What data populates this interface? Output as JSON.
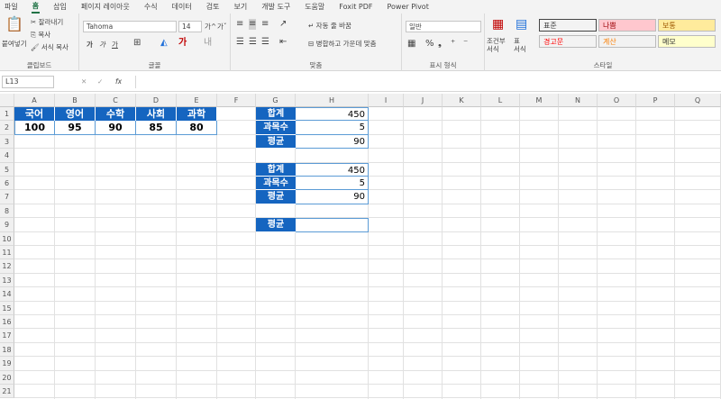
{
  "ribbon": {
    "tabs": [
      "파일",
      "홈",
      "삽입",
      "페이지 레이아웃",
      "수식",
      "데이터",
      "검토",
      "보기",
      "개발 도구",
      "도움말",
      "Foxit PDF",
      "Power Pivot"
    ],
    "active_tab": "홈",
    "clipboard": {
      "paste": "붙여넣기",
      "cut": "잘라내기",
      "copy": "복사",
      "format_painter": "서식 복사",
      "label": "클립보드"
    },
    "font": {
      "name": "Tahoma",
      "size": "14",
      "grow": "가^",
      "shrink": "가ˇ",
      "bold": "가",
      "italic": "가",
      "underline": "가",
      "label": "글꼴"
    },
    "alignment": {
      "wrap": "자동 줄 바꿈",
      "merge": "병합하고 가운데 맞춤",
      "label": "맞춤"
    },
    "number": {
      "format": "일반",
      "label": "표시 형식"
    },
    "styles": {
      "conditional": "조건부\n서식",
      "table": "표\n서식",
      "label": "스타일",
      "cells": [
        {
          "text": "표준",
          "bg": "#ffffff",
          "fg": "#000000"
        },
        {
          "text": "나쁨",
          "bg": "#ffc7ce",
          "fg": "#9c0006"
        },
        {
          "text": "보통",
          "bg": "#ffeb9c",
          "fg": "#9c5700"
        },
        {
          "text": "경고문",
          "bg": "#ffffff",
          "fg": "#ff0000"
        },
        {
          "text": "계산",
          "bg": "#f2f2f2",
          "fg": "#fa7d00"
        },
        {
          "text": "메모",
          "bg": "#ffffcc",
          "fg": "#000000"
        }
      ]
    }
  },
  "formula_bar": {
    "name_box": "L13",
    "cancel": "✕",
    "enter": "✓",
    "fx": "fx",
    "content": ""
  },
  "columns": [
    "A",
    "B",
    "C",
    "D",
    "E",
    "F",
    "G",
    "H",
    "I",
    "J",
    "K",
    "L",
    "M",
    "N",
    "O",
    "P",
    "Q"
  ],
  "rows": [
    "1",
    "2",
    "3",
    "4",
    "5",
    "6",
    "7",
    "8",
    "9",
    "10",
    "11",
    "12",
    "13",
    "14",
    "15",
    "16",
    "17",
    "18",
    "19",
    "20",
    "21"
  ],
  "table1": {
    "headers": [
      "국어",
      "영어",
      "수학",
      "사회",
      "과학"
    ],
    "values": [
      "100",
      "95",
      "90",
      "85",
      "80"
    ]
  },
  "summary1": [
    {
      "label": "합계",
      "value": "450"
    },
    {
      "label": "과목수",
      "value": "5"
    },
    {
      "label": "평균",
      "value": "90"
    }
  ],
  "summary2": [
    {
      "label": "합계",
      "value": "450"
    },
    {
      "label": "과목수",
      "value": "5"
    },
    {
      "label": "평균",
      "value": "90"
    }
  ],
  "summary3": [
    {
      "label": "평균",
      "value": ""
    }
  ],
  "colors": {
    "header_blue": "#1565c0",
    "border_blue": "#5b9bd5",
    "accent_green": "#217346"
  }
}
